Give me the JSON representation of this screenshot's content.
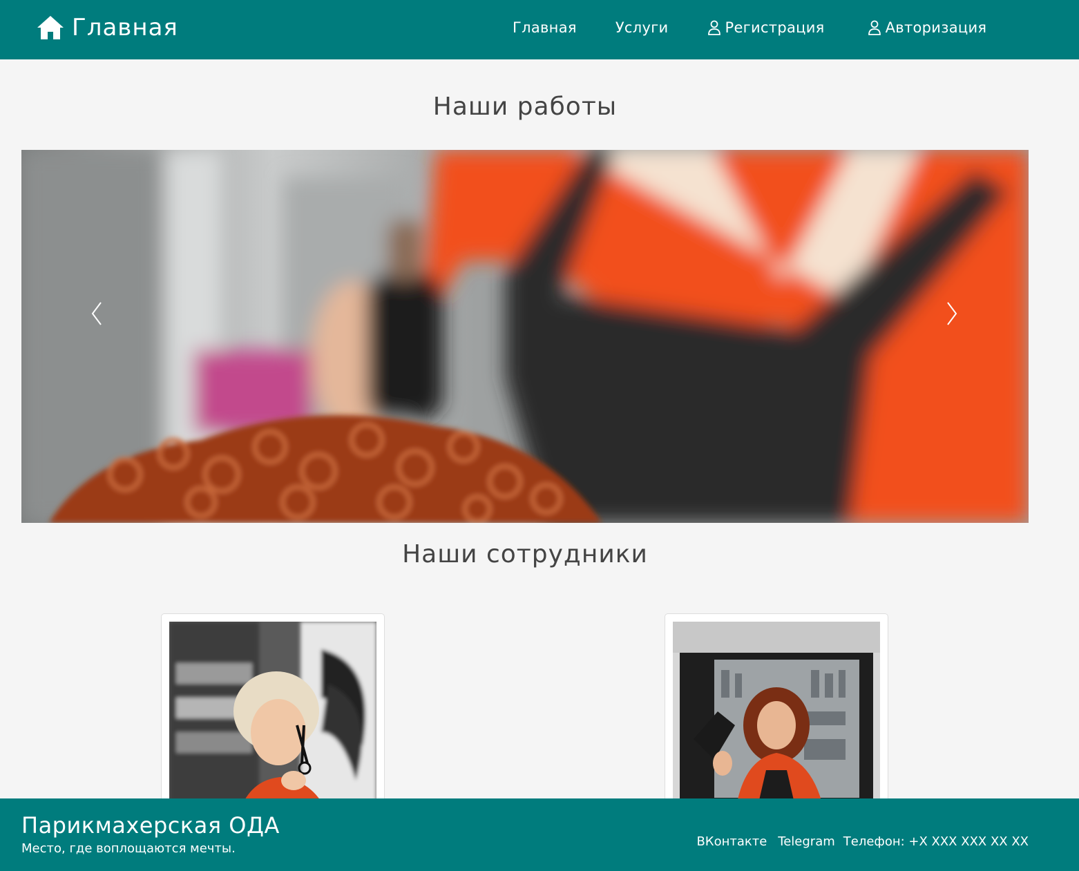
{
  "navbar": {
    "brand": "Главная",
    "brand_icon": "home-icon",
    "links": [
      {
        "label": "Главная"
      },
      {
        "label": "Услуги"
      },
      {
        "label": "Регистрация",
        "icon": "user-icon"
      },
      {
        "label": "Авторизация",
        "icon": "user-icon"
      }
    ]
  },
  "works": {
    "title": "Наши работы",
    "carousel": {
      "prev_icon": "chevron-left-icon",
      "next_icon": "chevron-right-icon"
    }
  },
  "staff": {
    "title": "Наши сотрудники"
  },
  "footer": {
    "name": "Парикмахерская ОДА",
    "slogan": "Место, где воплощаются мечты.",
    "links": [
      {
        "label": "ВКонтакте"
      },
      {
        "label": "Telegram"
      }
    ],
    "phone": "Телефон: +X XXX XXX XX XX"
  },
  "colors": {
    "primary": "#007c7d",
    "background": "#f5f5f5",
    "heading": "#444444"
  }
}
